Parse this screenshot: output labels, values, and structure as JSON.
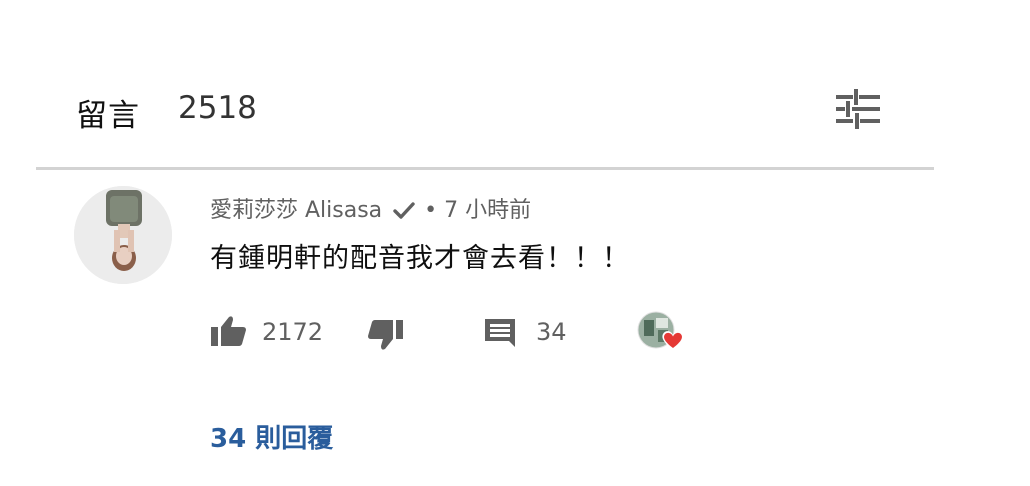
{
  "header": {
    "title": "留言",
    "count": "2518",
    "sort_icon": "sort-sliders-icon"
  },
  "comment": {
    "author": "愛莉莎莎 Alisasa",
    "verified_icon": "checkmark-icon",
    "separator": "•",
    "time": "7 小時前",
    "text": "有鍾明軒的配音我才會去看！！！",
    "likes": "2172",
    "replies_count": "34",
    "replies_link": "34 則回覆",
    "heart_color": "#e53935"
  },
  "colors": {
    "link": "#2a5d9c",
    "meta": "#606060",
    "divider": "#d3d3d3"
  }
}
